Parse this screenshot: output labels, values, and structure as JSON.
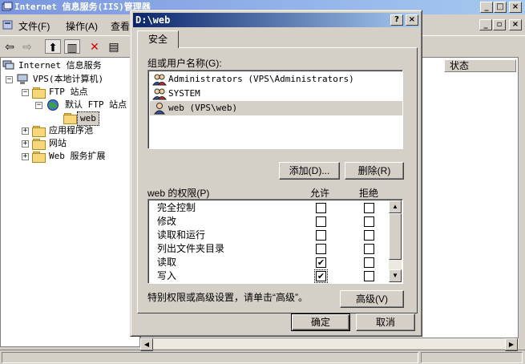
{
  "background_window": {
    "title": "Internet 信息服务(IIS)管理器",
    "menu": [
      "文件(F)",
      "操作(A)",
      "查看"
    ],
    "right_column_header": "状态",
    "tree": [
      {
        "label": "Internet 信息服务",
        "level": 0
      },
      {
        "label": "VPS(本地计算机)",
        "level": 1
      },
      {
        "label": "FTP 站点",
        "level": 2
      },
      {
        "label": "默认 FTP 站点",
        "level": 3
      },
      {
        "label": "web",
        "level": 4,
        "selected": true
      },
      {
        "label": "应用程序池",
        "level": 2
      },
      {
        "label": "网站",
        "level": 2
      },
      {
        "label": "Web 服务扩展",
        "level": 2
      }
    ]
  },
  "dialog": {
    "title": "D:\\web",
    "help_button": "?",
    "close_button": "×",
    "tab": "安全",
    "users_label": "组或用户名称(G):",
    "users": [
      {
        "name": "Administrators (VPS\\Administrators)",
        "selected": false
      },
      {
        "name": "SYSTEM",
        "selected": false
      },
      {
        "name": "web (VPS\\web)",
        "selected": true
      }
    ],
    "add_button": "添加(D)...",
    "remove_button": "删除(R)",
    "perms_label": "web 的权限(P)",
    "allow_header": "允许",
    "deny_header": "拒绝",
    "permissions": [
      {
        "name": "完全控制",
        "allow": false,
        "deny": false
      },
      {
        "name": "修改",
        "allow": false,
        "deny": false
      },
      {
        "name": "读取和运行",
        "allow": false,
        "deny": false
      },
      {
        "name": "列出文件夹目录",
        "allow": false,
        "deny": false
      },
      {
        "name": "读取",
        "allow": true,
        "deny": false
      },
      {
        "name": "写入",
        "allow": true,
        "deny": false
      }
    ],
    "advanced_note": "特别权限或高级设置，请单击“高级”。",
    "advanced_button": "高级(V)",
    "ok_button": "确定",
    "cancel_button": "取消"
  }
}
